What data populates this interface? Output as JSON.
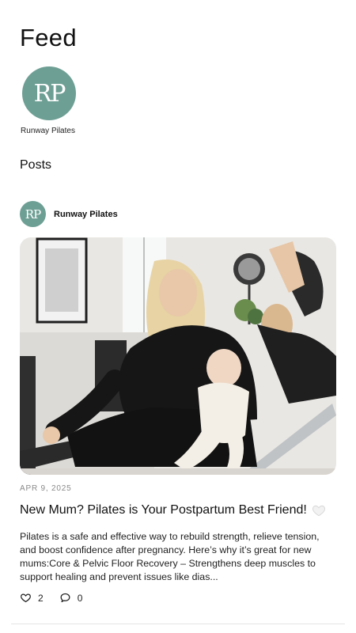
{
  "page": {
    "title": "Feed"
  },
  "account": {
    "name": "Runway Pilates",
    "avatar_initials": "RP",
    "avatar_color": "#6e9f94"
  },
  "posts_section": {
    "title": "Posts"
  },
  "post": {
    "author": "Runway Pilates",
    "author_initials": "RP",
    "date": "APR 9, 2025",
    "title": "New Mum? Pilates is Your Postpartum Best Friend!",
    "title_icon": "white-heart-icon",
    "excerpt": "Pilates is a safe and effective way to rebuild strength, relieve tension, and boost confidence after pregnancy. Here’s why it’s great for new mums:Core & Pelvic Floor Recovery – Strengthens deep muscles to support healing and prevent issues like dias...",
    "likes": "2",
    "comments": "0",
    "like_icon": "heart-outline-icon",
    "comment_icon": "comment-bubble-icon"
  }
}
